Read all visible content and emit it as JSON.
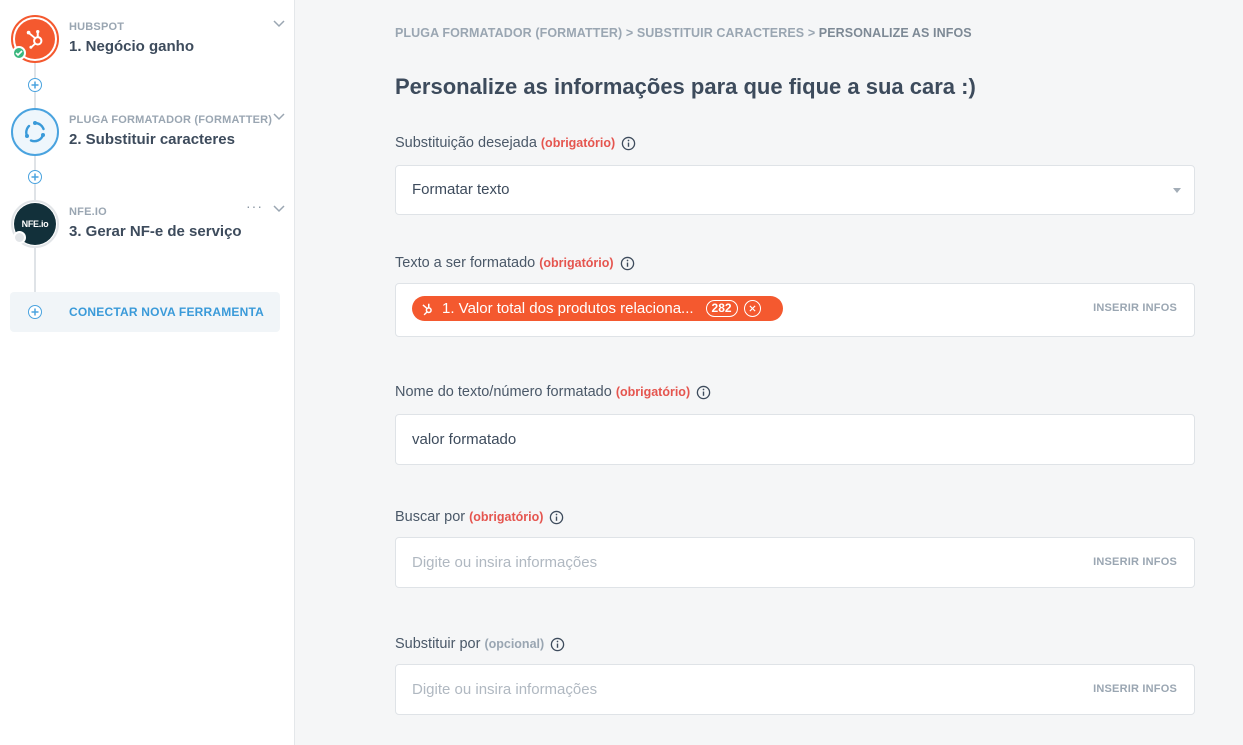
{
  "sidebar": {
    "steps": [
      {
        "app": "HUBSPOT",
        "title": "1. Negócio ganho"
      },
      {
        "app": "PLUGA FORMATADOR (FORMATTER)",
        "title": "2. Substituir caracteres"
      },
      {
        "app": "NFE.IO",
        "title": "3. Gerar NF-e de serviço",
        "menu": "···",
        "logo_text": "NFE.io"
      }
    ],
    "connect_label": "CONECTAR NOVA FERRAMENTA"
  },
  "main": {
    "breadcrumb": {
      "part1": "PLUGA FORMATADOR (FORMATTER)",
      "sep": " > ",
      "part2": "SUBSTITUIR CARACTERES",
      "part3": "PERSONALIZE AS INFOS"
    },
    "heading": "Personalize as informações para que fique a sua cara :)",
    "fields": [
      {
        "label": "Substituição desejada",
        "tag": "(obrigatório)",
        "value": "Formatar texto"
      },
      {
        "label": "Texto a ser formatado",
        "tag": "(obrigatório)",
        "pill_text": "1. Valor total dos produtos relaciona...",
        "pill_count": "282",
        "insert": "INSERIR INFOS"
      },
      {
        "label": "Nome do texto/número formatado",
        "tag": "(obrigatório)",
        "value": "valor formatado"
      },
      {
        "label": "Buscar por",
        "tag": "(obrigatório)",
        "placeholder": "Digite ou insira informações",
        "insert": "INSERIR INFOS"
      },
      {
        "label": "Substituir por",
        "tag": "(opcional)",
        "placeholder": "Digite ou insira informações",
        "insert": "INSERIR INFOS"
      }
    ]
  },
  "colors": {
    "hubspot": "#f4592f",
    "accent_blue": "#3a9ad9",
    "required": "#e5554f",
    "success": "#3bb77e"
  },
  "icons": [
    "hubspot-icon",
    "formatter-icon",
    "nfeio-logo",
    "chevron-down-icon",
    "plus-circle-icon",
    "info-icon",
    "close-icon",
    "check-icon"
  ]
}
